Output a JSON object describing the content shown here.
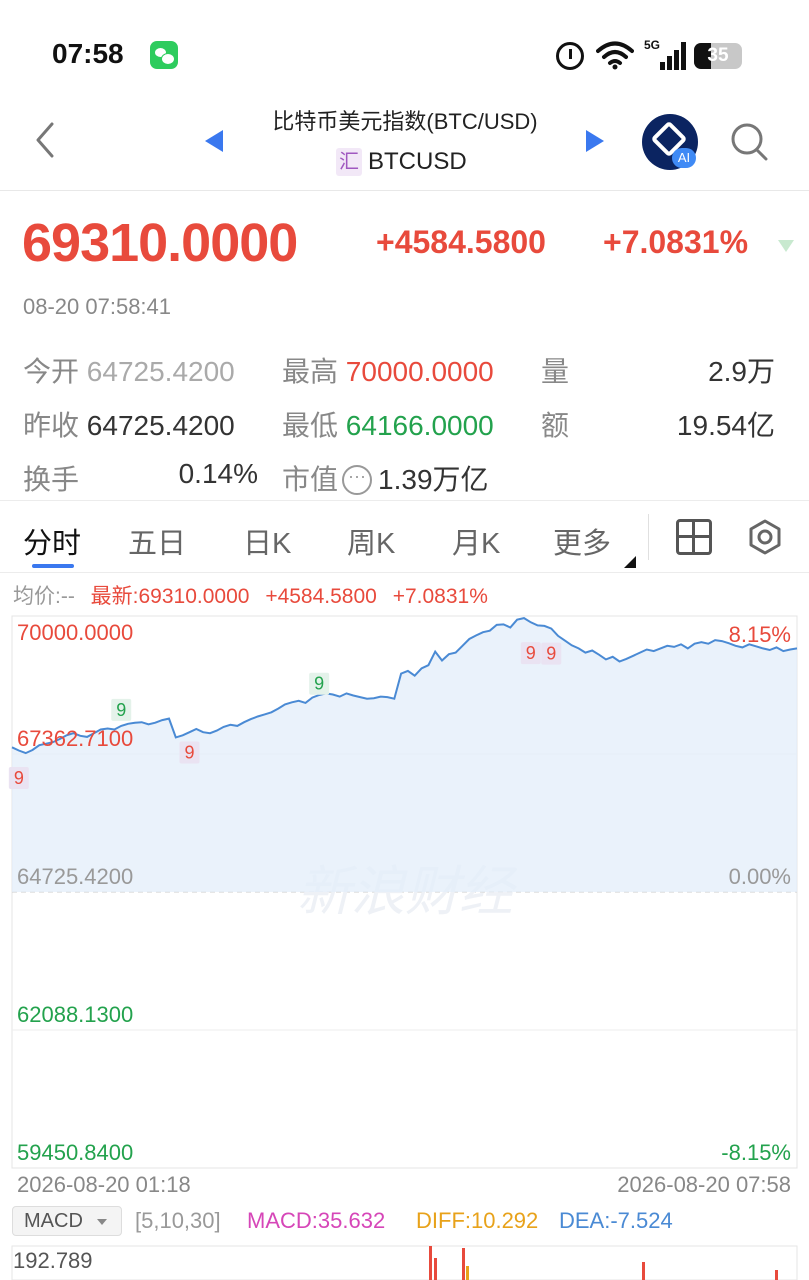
{
  "status_bar": {
    "time": "07:58",
    "network": "5G",
    "battery": "35"
  },
  "nav": {
    "title": "比特币美元指数(BTC/USD)",
    "type_badge": "汇",
    "symbol": "BTCUSD"
  },
  "quote": {
    "price": "69310.0000",
    "change": "+4584.5800",
    "change_pct": "+7.0831%",
    "timestamp": "08-20 07:58:41"
  },
  "stats": {
    "open_label": "今开",
    "open": "64725.4200",
    "high_label": "最高",
    "high": "70000.0000",
    "volume_label": "量",
    "volume": "2.9万",
    "prev_close_label": "昨收",
    "prev_close": "64725.4200",
    "low_label": "最低",
    "low": "64166.0000",
    "amount_label": "额",
    "amount": "19.54亿",
    "turnover_label": "换手",
    "turnover": "0.14%",
    "mktcap_label": "市值",
    "mktcap": "1.39万亿"
  },
  "tabs": [
    "分时",
    "五日",
    "日K",
    "周K",
    "月K",
    "更多"
  ],
  "legend": {
    "avg": "均价:--",
    "latest": "最新:69310.0000",
    "change": "+4584.5800",
    "change_pct": "+7.0831%"
  },
  "chart_data": {
    "type": "area",
    "title": "",
    "xlabel": "",
    "ylabel": "",
    "y_labels_left": [
      "70000.0000",
      "67362.7100",
      "64725.4200",
      "62088.1300",
      "59450.8400"
    ],
    "y_labels_right": [
      "8.15%",
      "0.00%",
      "-8.15%"
    ],
    "ylim": [
      59450.84,
      70000.0
    ],
    "reference_line": 64725.42,
    "x_start": "2026-08-20 01:18",
    "x_end": "2026-08-20 07:58",
    "watermark": "新浪财经",
    "marker_text": "9",
    "series": [
      {
        "values": [
          67490,
          67430,
          67380,
          67440,
          67530,
          67560,
          67590,
          67650,
          67720,
          67760,
          67710,
          67690,
          67760,
          67830,
          67850,
          67830,
          67900,
          67940,
          67960,
          67970,
          67930,
          67960,
          68010,
          68040,
          67680,
          67720,
          67780,
          67840,
          67780,
          67760,
          67810,
          67880,
          67920,
          67900,
          67970,
          68030,
          68080,
          68120,
          68160,
          68230,
          68310,
          68350,
          68380,
          68340,
          68440,
          68490,
          68520,
          68500,
          68460,
          68520,
          68480,
          68450,
          68420,
          68430,
          68460,
          68450,
          68420,
          68900,
          68950,
          68860,
          69000,
          69060,
          69320,
          69150,
          69270,
          69300,
          69430,
          69560,
          69630,
          69690,
          69720,
          69830,
          69840,
          69780,
          69930,
          69960,
          69880,
          69820,
          69810,
          69760,
          69620,
          69530,
          69440,
          69380,
          69300,
          69340,
          69260,
          69170,
          69220,
          69130,
          69180,
          69240,
          69300,
          69360,
          69330,
          69380,
          69430,
          69410,
          69460,
          69380,
          69470,
          69500,
          69470,
          69540,
          69520,
          69480,
          69430,
          69400,
          69460,
          69420,
          69380,
          69350,
          69400,
          69330,
          69360,
          69380
        ]
      }
    ],
    "markers": [
      {
        "x_index": 1,
        "value": 67362.71,
        "color": "red"
      },
      {
        "x_index": 16,
        "value": 67900,
        "color": "green"
      },
      {
        "x_index": 26,
        "value": 67850,
        "color": "red"
      },
      {
        "x_index": 45,
        "value": 68400,
        "color": "green"
      },
      {
        "x_index": 76,
        "value": 69750,
        "color": "red"
      },
      {
        "x_index": 79,
        "value": 69740,
        "color": "red"
      }
    ]
  },
  "macd": {
    "selector": "MACD",
    "params": "[5,10,30]",
    "macd": "MACD:35.632",
    "diff": "DIFF:10.292",
    "dea": "DEA:-7.524",
    "top_value": "192.789"
  },
  "colors": {
    "up": "#e84a3c",
    "down": "#23a24d",
    "accent": "#3a78ef",
    "line": "#4a8ad4"
  }
}
